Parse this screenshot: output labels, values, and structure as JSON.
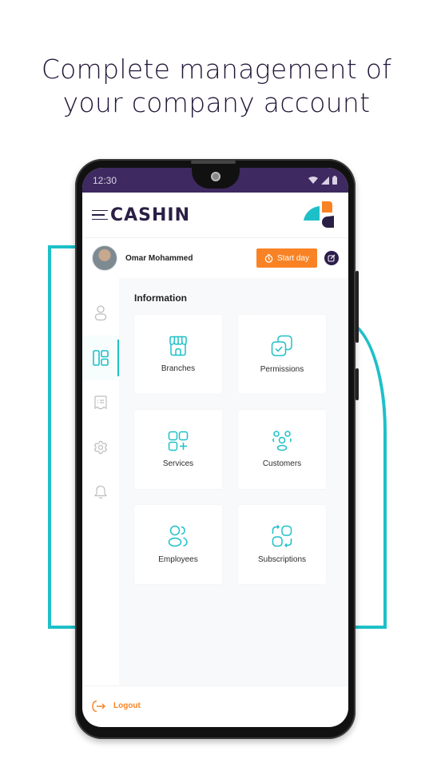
{
  "headline": {
    "line1": "Complete management of",
    "line2": "your company account"
  },
  "statusbar": {
    "time": "12:30",
    "icons": [
      "wifi-icon",
      "signal-icon",
      "battery-icon"
    ]
  },
  "appbar": {
    "brand": "CASHIN",
    "menu_icon": "hamburger-icon",
    "logo_icon": "cashin-logo-mark"
  },
  "user": {
    "name": "Omar Mohammed",
    "start_day_label": "Start day",
    "start_day_icon": "timer-icon",
    "edit_icon": "edit-icon"
  },
  "rail": {
    "items": [
      {
        "icon": "user-icon",
        "active": false
      },
      {
        "icon": "dashboard-icon",
        "active": true
      },
      {
        "icon": "receipt-icon",
        "active": false
      },
      {
        "icon": "settings-icon",
        "active": false
      },
      {
        "icon": "bell-icon",
        "active": false
      }
    ]
  },
  "main": {
    "section_title": "Information",
    "tiles": [
      {
        "label": "Branches",
        "icon": "store-icon"
      },
      {
        "label": "Permissions",
        "icon": "permissions-icon"
      },
      {
        "label": "Services",
        "icon": "services-icon"
      },
      {
        "label": "Customers",
        "icon": "customers-icon"
      },
      {
        "label": "Employees",
        "icon": "employees-icon"
      },
      {
        "label": "Subscriptions",
        "icon": "subscriptions-icon"
      }
    ]
  },
  "footer": {
    "logout_label": "Logout",
    "logout_icon": "logout-icon"
  },
  "colors": {
    "accent_teal": "#1ec0c8",
    "accent_orange": "#f98324",
    "brand_purple": "#2a1f45",
    "statusbar_purple": "#3e2960"
  }
}
